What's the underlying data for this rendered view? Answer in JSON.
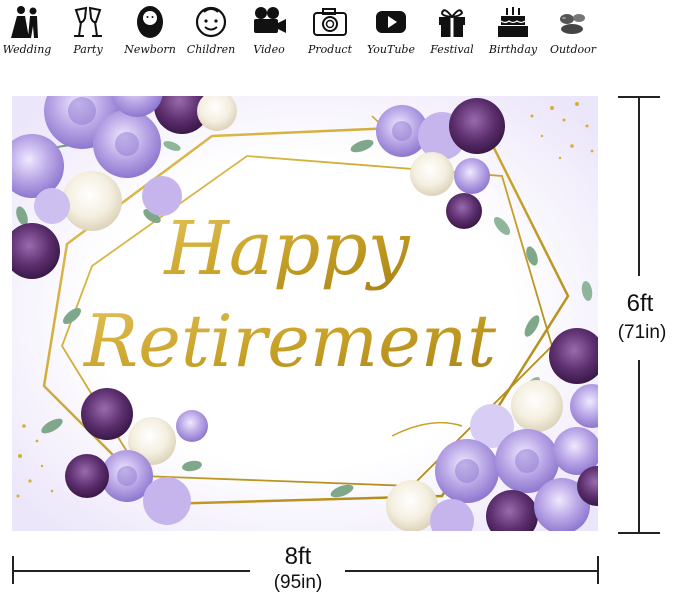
{
  "categories": [
    {
      "label": "Wedding",
      "icon": "wedding-couple-icon"
    },
    {
      "label": "Party",
      "icon": "champagne-glasses-icon"
    },
    {
      "label": "Newborn",
      "icon": "baby-swaddled-icon"
    },
    {
      "label": "Children",
      "icon": "child-face-icon"
    },
    {
      "label": "Video",
      "icon": "film-camera-icon"
    },
    {
      "label": "Product",
      "icon": "photo-camera-icon"
    },
    {
      "label": "YouTube",
      "icon": "youtube-play-icon"
    },
    {
      "label": "Festival",
      "icon": "gift-box-icon"
    },
    {
      "label": "Birthday",
      "icon": "birthday-cake-icon"
    },
    {
      "label": "Outdoor",
      "icon": "stones-icon"
    }
  ],
  "banner": {
    "line1": "Happy",
    "line2": "Retirement",
    "gold_color": "#c9a227",
    "flower_colors": [
      "#b9a6e6",
      "#5c2f6e",
      "#f4efe0"
    ]
  },
  "dimensions": {
    "height_ft": "6ft",
    "height_in": "(71in)",
    "width_ft": "8ft",
    "width_in": "(95in)"
  }
}
